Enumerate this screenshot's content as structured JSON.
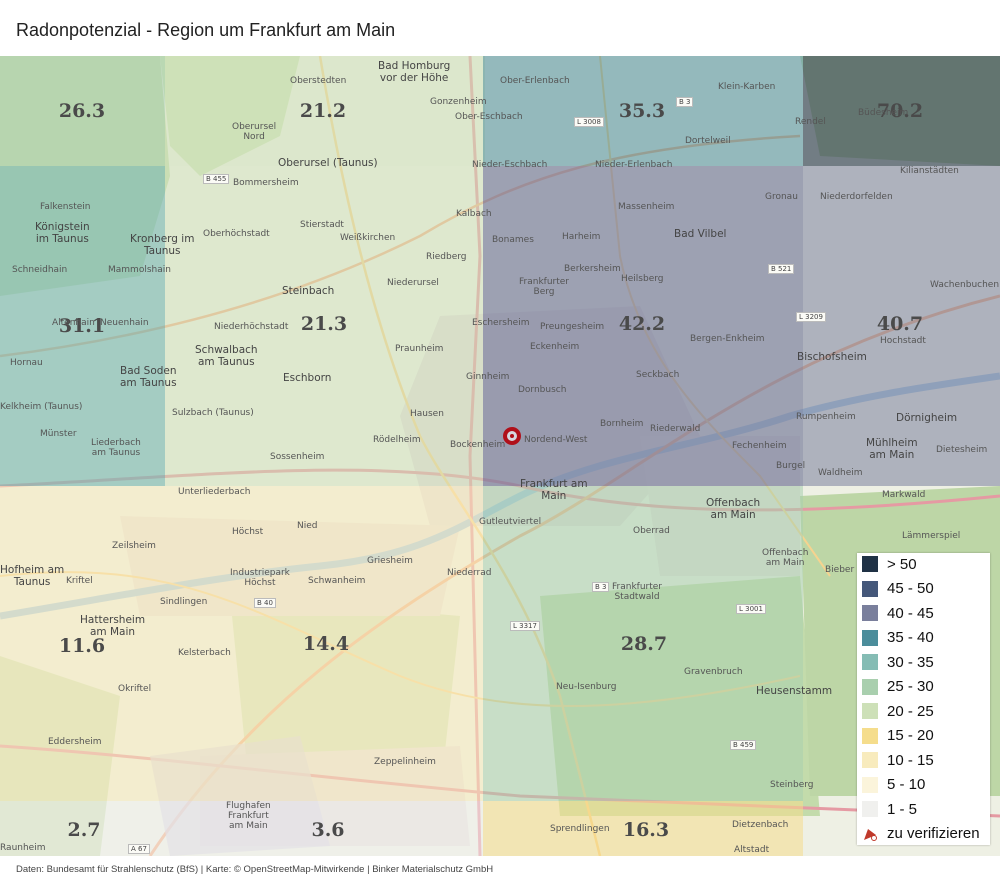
{
  "title": "Radonpotenzial - Region um Frankfurt am Main",
  "footer": "Daten: Bundesamt für Strahlenschutz (BfS)  |  Karte: © OpenStreetMap-Mitwirkende  |  Binker Materialschutz GmbH",
  "cells": [
    {
      "value": "26.3",
      "class": "25 - 30"
    },
    {
      "value": "21.2",
      "class": "20 - 25"
    },
    {
      "value": "35.3",
      "class": "35 - 40"
    },
    {
      "value": "70.2",
      "class": "> 50"
    },
    {
      "value": "31.1",
      "class": "30 - 35"
    },
    {
      "value": "21.3",
      "class": "20 - 25"
    },
    {
      "value": "42.2",
      "class": "40 - 45"
    },
    {
      "value": "40.7",
      "class": "40 - 45"
    },
    {
      "value": "11.6",
      "class": "10 - 15"
    },
    {
      "value": "14.4",
      "class": "10 - 15"
    },
    {
      "value": "28.7",
      "class": "25 - 30"
    },
    {
      "value": "2.7",
      "class": "1 - 5"
    },
    {
      "value": "3.6",
      "class": "1 - 5"
    },
    {
      "value": "16.3",
      "class": "15 - 20"
    }
  ],
  "legend": [
    {
      "label": "> 50",
      "color": "#1f3145"
    },
    {
      "label": "45 - 50",
      "color": "#45587a"
    },
    {
      "label": "40 - 45",
      "color": "#7a7f9c"
    },
    {
      "label": "35 - 40",
      "color": "#4b8d9b"
    },
    {
      "label": "30 - 35",
      "color": "#85bcb4"
    },
    {
      "label": "25 - 30",
      "color": "#a9cfae"
    },
    {
      "label": "20 - 25",
      "color": "#cde0b8"
    },
    {
      "label": "15 - 20",
      "color": "#f5dd8c"
    },
    {
      "label": "10 - 15",
      "color": "#f8ebbd"
    },
    {
      "label": "5 - 10",
      "color": "#fbf4db"
    },
    {
      "label": "1 - 5",
      "color": "#f0f0ee"
    },
    {
      "label": "zu verifizieren",
      "color": "#c0392b"
    }
  ],
  "places": [
    "Bad Homburg\nvor der Höhe",
    "Oberstedten",
    "Gonzenheim",
    "Ober-Erlenbach",
    "Klein-Karben",
    "Oberursel\nNord",
    "Ober-Eschbach",
    "Rendel",
    "Büdesheim",
    "Oberursel (Taunus)",
    "Dortelweil",
    "Nieder-Eschbach",
    "Nieder-Erlenbach",
    "Kilianstädten",
    "Bommersheim",
    "Falkenstein",
    "Königstein\nim Taunus",
    "Kronberg im\nTaunus",
    "Kalbach",
    "Massenheim",
    "Gronau",
    "Niederdorfelden",
    "Oberhöchstadt",
    "Stierstadt",
    "Weißkirchen",
    "Bonames",
    "Harheim",
    "Bad Vilbel",
    "Schneidhain",
    "Mammolshain",
    "Riedberg",
    "Berkersheim",
    "Steinbach",
    "Niederursel",
    "Frankfurter\nBerg",
    "Heilsberg",
    "Wachenbuchen",
    "Altenhain",
    "Neuenhain",
    "Niederhöchstadt",
    "Eschersheim",
    "Preungesheim",
    "Hochstadt",
    "Schwalbach\nam Taunus",
    "Praunheim",
    "Eckenheim",
    "Bergen-Enkheim",
    "Bischofsheim",
    "Hornau",
    "Bad Soden\nam Taunus",
    "Eschborn",
    "Ginnheim",
    "Dornbusch",
    "Seckbach",
    "Sulzbach (Taunus)",
    "Hausen",
    "Rumpenheim",
    "Dörnigheim",
    "Kelkheim (Taunus)",
    "Münster",
    "Liederbach\nam Taunus",
    "Rödelheim",
    "Bockenheim",
    "Nordend-West",
    "Bornheim",
    "Riederwald",
    "Fechenheim",
    "Mühlheim\nam Main",
    "Dietesheim",
    "Sossenheim",
    "Burgel",
    "Waldheim",
    "Frankfurt am\nMain",
    "Offenbach\nam Main",
    "Unterliederbach",
    "Markwald",
    "Gutleutviertel",
    "Nied",
    "Oberrad",
    "Höchst",
    "Lämmerspiel",
    "Zeilsheim",
    "Griesheim",
    "Offenbach\nam Main",
    "Hofheim am\nTaunus",
    "Kriftel",
    "Schwanheim",
    "Niederrad",
    "Bieber",
    "Industriepark\nHöchst",
    "Sindlingen",
    "Frankfurter\nStadtwald",
    "Hattersheim\nam Main",
    "Okriftel",
    "Kelsterbach",
    "Neu-Isenburg",
    "Gravenbruch",
    "Heusenstamm",
    "Eddersheim",
    "Zeppelinheim",
    "Steinberg",
    "Sprendlingen",
    "Dietzenbach",
    "Raunheim",
    "Flughafen\nFrankfurt\nam Main",
    "Altstadt"
  ],
  "roads": [
    "B 455",
    "L 3008",
    "B 3",
    "B 521",
    "L 3209",
    "B 40",
    "B 3",
    "L 3317",
    "L 3001",
    "B 459",
    "A 67"
  ]
}
